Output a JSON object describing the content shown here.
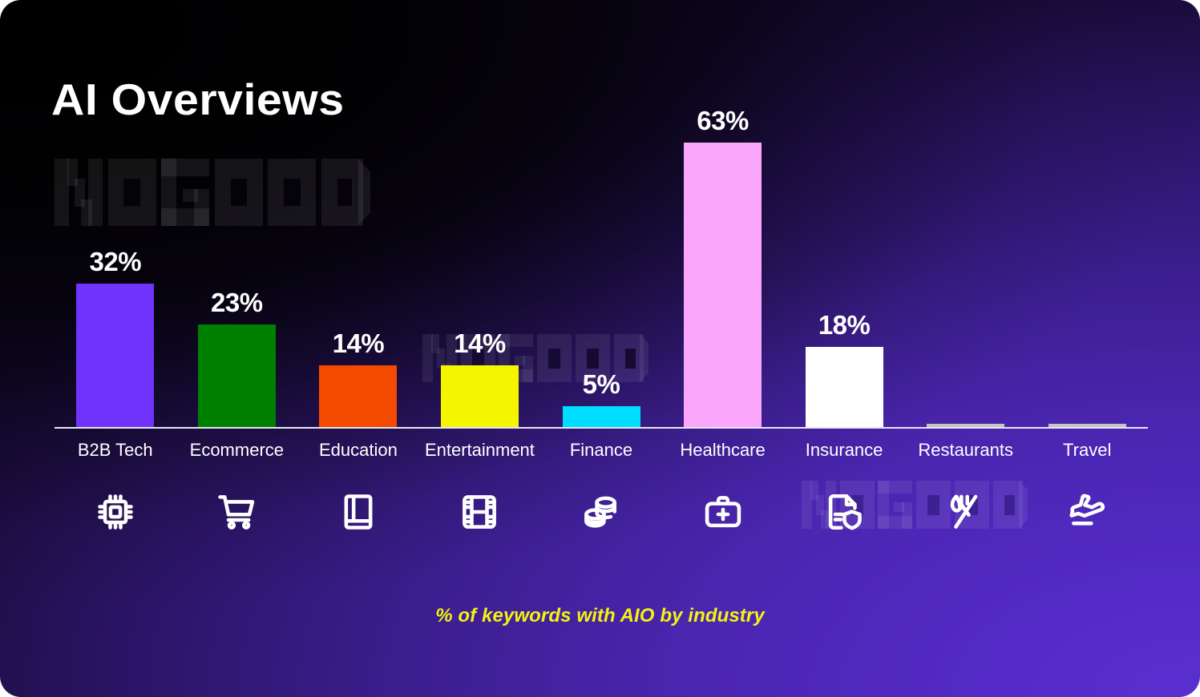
{
  "title": "AI Overviews",
  "caption": "% of keywords with AIO by industry",
  "watermark_text": "NOGOOD",
  "colors": {
    "bg_dark": "#000000",
    "bg_purple": "#5129c2",
    "axis": "#e8e6f2",
    "label_text": "#ffffff",
    "caption": "#f3f311"
  },
  "chart_data": {
    "type": "bar",
    "title": "AI Overviews",
    "subtitle": "% of keywords with AIO by industry",
    "xlabel": "",
    "ylabel": "% of keywords with AIO",
    "ylim": [
      0,
      70
    ],
    "grid": false,
    "legend": null,
    "value_suffix": "%",
    "categories": [
      "B2B Tech",
      "Ecommerce",
      "Education",
      "Entertainment",
      "Finance",
      "Healthcare",
      "Insurance",
      "Restaurants",
      "Travel"
    ],
    "values": [
      32,
      23,
      14,
      14,
      5,
      63,
      18,
      1,
      1
    ],
    "value_labels": [
      "32%",
      "23%",
      "14%",
      "14%",
      "5%",
      "63%",
      "18%",
      "",
      ""
    ],
    "bar_colors": [
      "#6f33fb",
      "#008000",
      "#f44a00",
      "#f5f500",
      "#00ddff",
      "#f9a6fb",
      "#ffffff",
      "#c5c5c5",
      "#c5c5c5"
    ],
    "icons": [
      "cpu-chip-icon",
      "shopping-cart-icon",
      "book-icon",
      "film-strip-icon",
      "coins-stack-icon",
      "medical-bag-icon",
      "document-shield-icon",
      "fork-knife-icon",
      "airplane-icon"
    ]
  }
}
